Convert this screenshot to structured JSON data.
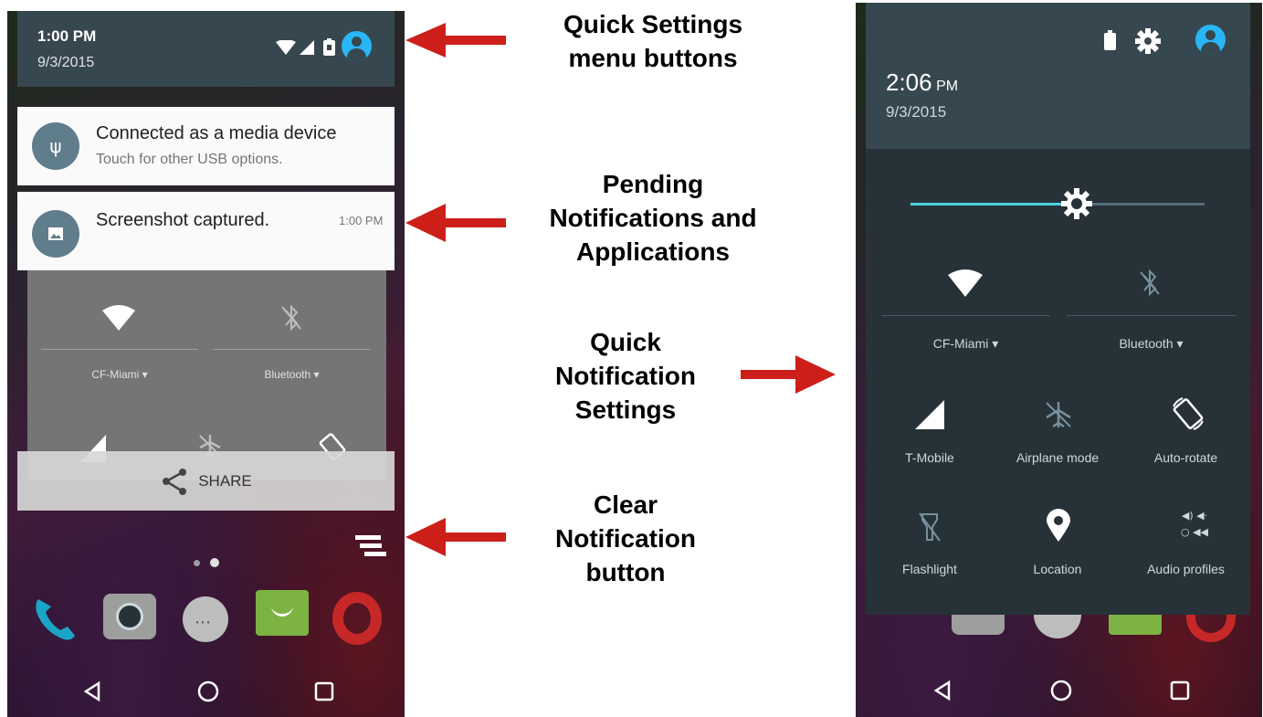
{
  "left_phone": {
    "status": {
      "time": "1:00 PM",
      "date": "9/3/2015"
    },
    "notifications": [
      {
        "title": "Connected as a media device",
        "subtitle": "Touch for other USB options.",
        "icon": "usb-icon"
      },
      {
        "title": "Screenshot captured.",
        "time": "1:00 PM",
        "icon": "image-icon"
      }
    ],
    "quick_settings": {
      "wifi_label": "CF-Miami",
      "bluetooth_label": "Bluetooth",
      "tiles": [
        "T-Mobile",
        "Airplane mode",
        "Auto-rotate"
      ]
    },
    "share_label": "SHARE"
  },
  "right_phone": {
    "status": {
      "time": "2:06",
      "ampm": "PM",
      "date": "9/3/2015"
    },
    "brightness": 0.55,
    "wifi_label": "CF-Miami",
    "bluetooth_label": "Bluetooth",
    "tiles_row1": [
      "T-Mobile",
      "Airplane mode",
      "Auto-rotate"
    ],
    "tiles_row2": [
      "Flashlight",
      "Location",
      "Audio profiles"
    ]
  },
  "annotations": {
    "quick_settings": [
      "Quick Settings",
      "menu buttons"
    ],
    "pending": [
      "Pending",
      "Notifications and",
      "Applications"
    ],
    "quick_notif": [
      "Quick",
      "Notification",
      "Settings"
    ],
    "clear": [
      "Clear",
      "Notification",
      "button"
    ]
  },
  "colors": {
    "arrow": "#cc1f1a",
    "accent": "#4dd0e1"
  }
}
